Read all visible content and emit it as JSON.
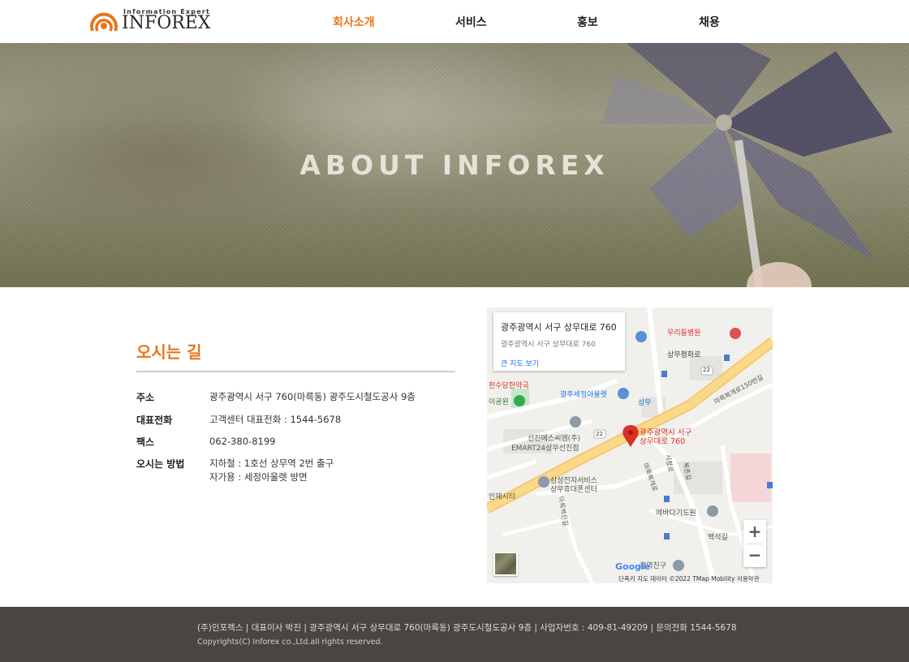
{
  "header": {
    "logo_tagline": "Information Expert",
    "logo_word": "INFOREX",
    "nav": [
      {
        "label": "회사소개",
        "active": true
      },
      {
        "label": "서비스",
        "active": false
      },
      {
        "label": "홍보",
        "active": false
      },
      {
        "label": "채용",
        "active": false
      }
    ]
  },
  "hero": {
    "title": "ABOUT INFOREX"
  },
  "directions": {
    "title": "오시는 길",
    "rows": [
      {
        "label": "주소",
        "value": "광주광역시 서구 760(마륵동) 광주도시철도공사 9층"
      },
      {
        "label": "대표전화",
        "value": "고객센터 대표전화 : 1544-5678"
      },
      {
        "label": "팩스",
        "value": "062-380-8199"
      },
      {
        "label": "오시는 방법",
        "value": "지하철 : 1호선 상무역 2번 출구",
        "value2": "자가용 : 세정아울렛 방면"
      }
    ]
  },
  "map": {
    "card_title": "광주광역시 서구 상무대로 760",
    "card_sub": "광주광역시 서구 상무대로 760",
    "card_link": "큰 지도 보기",
    "pin_label_1": "광주광역시 서구",
    "pin_label_2": "상무대로 760",
    "labels": {
      "hospital": "우리들병원",
      "sangmu_hwaro": "상무평화로",
      "pharmacy": "천수당한약국",
      "park": "이공원",
      "outlet": "광주세정아울렛",
      "station": "상무",
      "emart_1": "선진에스씨엠(주)",
      "emart_2": "EMART24상무선진점",
      "samsung_1": "삼성전자서비스",
      "samsung_2": "상무휴대폰센터",
      "injae": "인재시티",
      "ebadagi": "에바다기도원",
      "baekseok": "백석길",
      "road_150": "마륵복개로150번길",
      "marok_ro": "마륵복개로",
      "sicheong": "시청로",
      "bukcheon": "북촌길",
      "marok_byeok": "마륵벽진길",
      "gwangyeok": "광역친구",
      "road22": "22",
      "road22b": "22"
    },
    "zoom_in": "+",
    "zoom_out": "−",
    "google": "Google",
    "footer_text": "단축키   지도 데이터 ©2022 TMap Mobility   이용약관"
  },
  "footer": {
    "line1": "(주)인포렉스  |  대표이사 박진  |  광주광역시 서구 상무대로 760(마륵동) 광주도시철도공사 9층  |  사업자번호 : 409-81-49209  |  문의전화 1544-5678",
    "line2": "Copyrights(C) Inforex co.,Ltd.all rights reserved."
  },
  "colors": {
    "accent": "#e8751a",
    "footer_bg": "#4a4541"
  }
}
